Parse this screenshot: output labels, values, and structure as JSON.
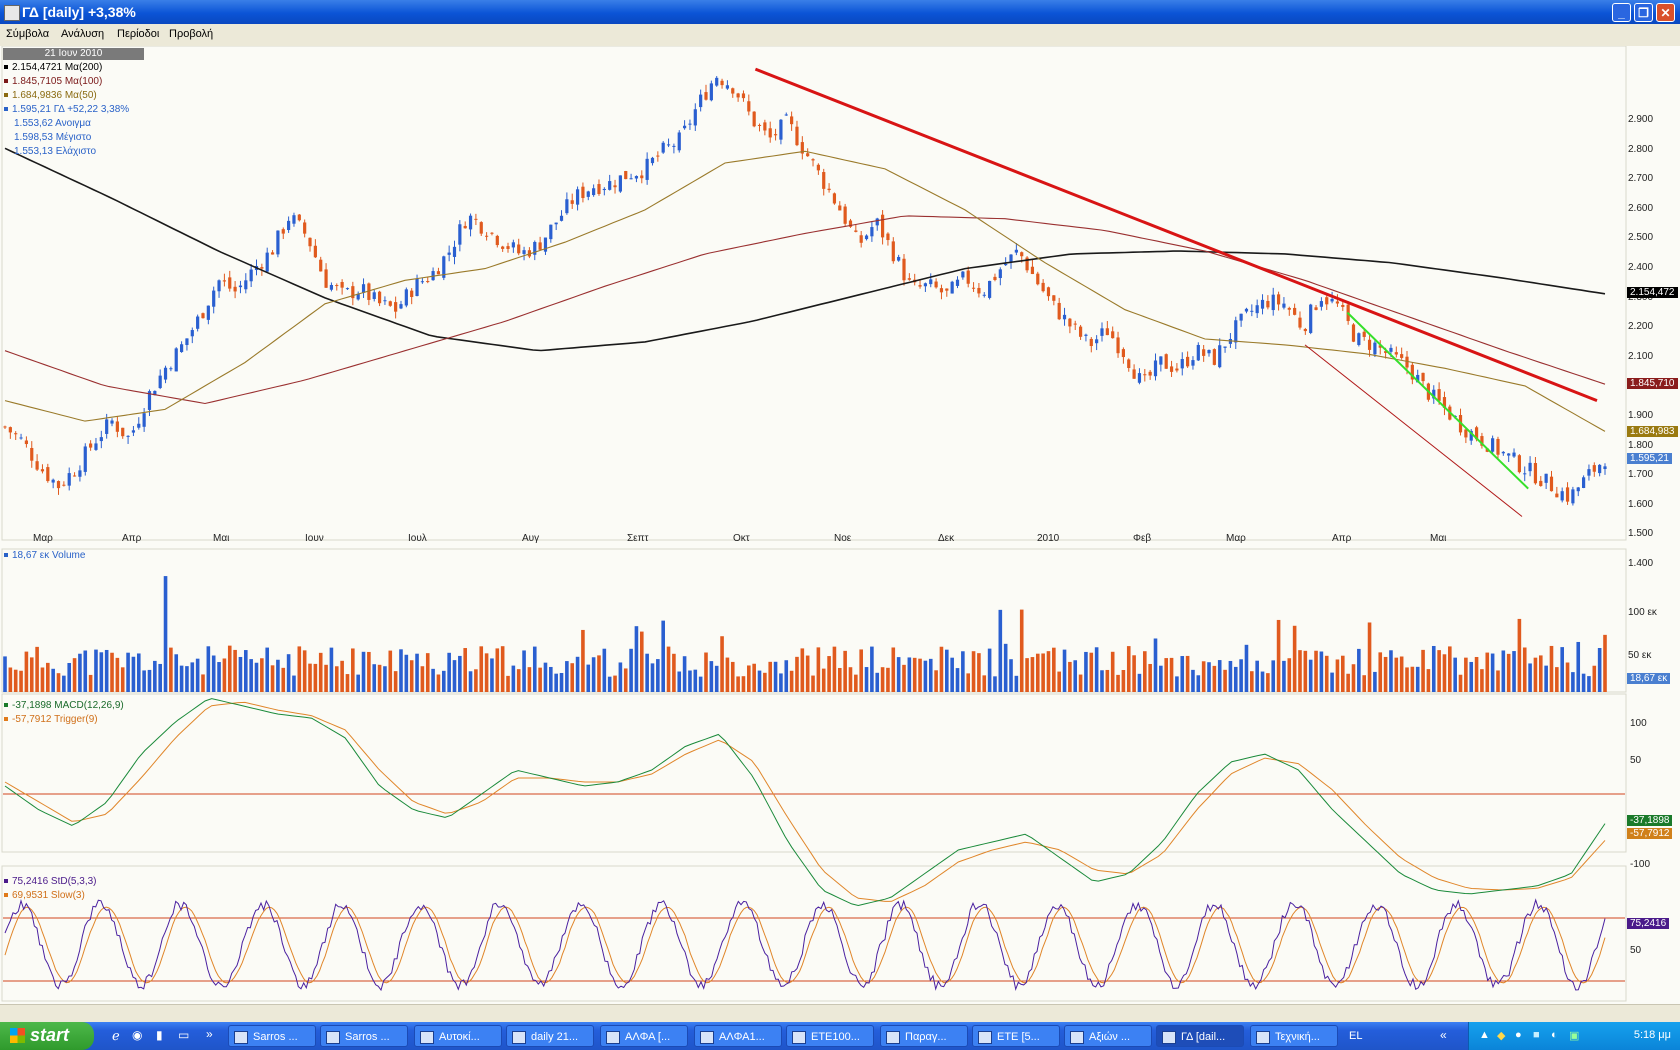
{
  "window": {
    "title": "ΓΔ [daily] +3,38%"
  },
  "menu": [
    "Σύμβολα",
    "Ανάλυση",
    "Περίοδοι",
    "Προβολή"
  ],
  "date_box": "21 Ιουν 2010",
  "info_lines": [
    {
      "text": "2.154,4721 Mα(200)",
      "color": "#000000"
    },
    {
      "text": "1.845,7105 Mα(100)",
      "color": "#7a1818"
    },
    {
      "text": "1.684,9836 Mα(50)",
      "color": "#8a6a10"
    },
    {
      "text": "1.595,21 ΓΔ +52,22 3,38%",
      "color": "#2a62c8"
    },
    {
      "text": "1.553,62 Ανοιγμα",
      "color": "#2a62c8"
    },
    {
      "text": "1.598,53 Μέγιστο",
      "color": "#2a62c8"
    },
    {
      "text": "1.553,13 Ελάχιστο",
      "color": "#2a62c8"
    }
  ],
  "price_axis": [
    "2.900",
    "2.800",
    "2.700",
    "2.600",
    "2.500",
    "2.400",
    "2.300",
    "2.200",
    "2.100",
    "2.000",
    "1.900",
    "1.800",
    "1.700",
    "1.600",
    "1.500",
    "1.400"
  ],
  "months": [
    "Μαρ",
    "Απρ",
    "Μαι",
    "Ιουν",
    "Ιουλ",
    "Αυγ",
    "Σεπτ",
    "Οκτ",
    "Νοε",
    "Δεκ",
    "2010",
    "Φεβ",
    "Μαρ",
    "Απρ",
    "Μαι"
  ],
  "price_tags": [
    {
      "text": "2.154,472",
      "bg": "#000000"
    },
    {
      "text": "1.845,710",
      "bg": "#8a1c1c"
    },
    {
      "text": "1.684,983",
      "bg": "#9a7a10"
    },
    {
      "text": "1.595,21",
      "bg": "#4a7fd0"
    }
  ],
  "volume_panel": {
    "label": "18,67 εκ Volume",
    "axis": [
      "100 εκ",
      "50 εκ"
    ],
    "tag": "18,67 εκ"
  },
  "macd_panel": {
    "label1": "-37,1898 MACD(12,26,9)",
    "label2": "-57,7912 Trigger(9)",
    "axis": [
      "100",
      "50",
      "-100"
    ],
    "tag1": "-37,1898",
    "tag2": "-57,7912"
  },
  "stoch_panel": {
    "label1": "75,2416 StD(5,3,3)",
    "label2": "69,9531 Slow(3)",
    "axis": [
      "50"
    ],
    "tag1": "75,2416"
  },
  "chart_data": {
    "type": "candlestick",
    "y_axis_range": [
      1400,
      2900
    ],
    "x_axis_labels": [
      "Μαρ",
      "Απρ",
      "Μαι",
      "Ιουν",
      "Ιουλ",
      "Αυγ",
      "Σεπτ",
      "Οκτ",
      "Νοε",
      "Δεκ",
      "2010",
      "Φεβ",
      "Μαρ",
      "Απρ",
      "Μαι"
    ],
    "close_path": [
      1700,
      1650,
      1560,
      1500,
      1560,
      1650,
      1720,
      1660,
      1800,
      1900,
      1980,
      2080,
      2200,
      2160,
      2240,
      2300,
      2420,
      2350,
      2200,
      2150,
      2170,
      2120,
      2100,
      2180,
      2220,
      2300,
      2420,
      2380,
      2330,
      2290,
      2320,
      2400,
      2480,
      2520,
      2530,
      2560,
      2580,
      2640,
      2680,
      2800,
      2900,
      2860,
      2750,
      2680,
      2740,
      2640,
      2540,
      2440,
      2320,
      2400,
      2290,
      2170,
      2180,
      2150,
      2210,
      2160,
      2240,
      2300,
      2200,
      2110,
      2040,
      1980,
      2030,
      1950,
      1840,
      1920,
      1900,
      1960,
      1930,
      2020,
      2090,
      2130,
      2120,
      2040,
      2150,
      2110,
      2000,
      1980,
      1940,
      1900,
      1820,
      1760,
      1700,
      1660,
      1620,
      1580,
      1540,
      1500,
      1460,
      1530,
      1595
    ],
    "ma200_path": [
      2650,
      2480,
      2300,
      2140,
      2010,
      1960,
      1990,
      2060,
      2150,
      2240,
      2290,
      2300,
      2290,
      2260,
      2210,
      2154
    ],
    "ma100_path": [
      1960,
      1840,
      1780,
      1860,
      1960,
      2060,
      2180,
      2290,
      2360,
      2420,
      2410,
      2370,
      2300,
      2200,
      2080,
      1960,
      1846
    ],
    "ma50_path": [
      1790,
      1720,
      1760,
      1920,
      2120,
      2200,
      2240,
      2330,
      2440,
      2600,
      2640,
      2580,
      2440,
      2260,
      2100,
      2000,
      1980,
      1950,
      1900,
      1840,
      1685
    ],
    "trendlines": [
      {
        "name": "long downtrend",
        "color": "#d81414",
        "from": [
          2920,
          0.469
        ],
        "to": [
          1790,
          0.995
        ]
      },
      {
        "name": "short downtrend",
        "color": "#35e02a",
        "from": [
          2090,
          0.839
        ],
        "to": [
          1490,
          0.952
        ]
      }
    ],
    "last_close": 1595.21,
    "volume_last": "18,67 εκ",
    "macd_last": -37.1898,
    "trigger_last": -57.7912,
    "stoch_last": 75.2416,
    "slow_last": 69.9531
  },
  "taskbar": {
    "start": "start",
    "tasks": [
      "Sarros ...",
      "Sarros ...",
      "Αυτοκί...",
      "daily 21...",
      "ΑΛΦΑ [...",
      "ΑΛΦΑ1...",
      "ΕΤΕ100...",
      "Παραγ...",
      "ΕΤΕ [5...",
      "Αξιών ...",
      "ΓΔ [dail...",
      "Τεχνική..."
    ],
    "lang": "EL",
    "clock": "5:18 μμ"
  }
}
